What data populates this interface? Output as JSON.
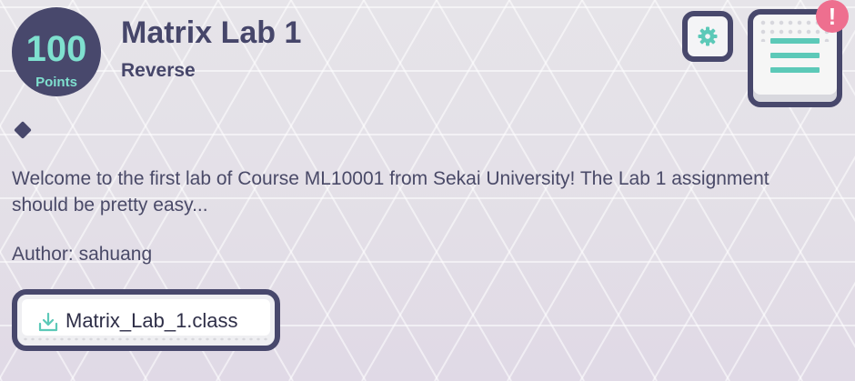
{
  "challenge": {
    "points_value": "100",
    "points_label": "Points",
    "title": "Matrix Lab 1",
    "category": "Reverse",
    "description": "Welcome to the first lab of Course ML10001 from Sekai University! The Lab 1 assignment should be pretty easy...",
    "author_label": "Author:",
    "author_name": "sahuang",
    "attachment_name": "Matrix_Lab_1.class"
  },
  "controls": {
    "settings_icon": "gear-icon",
    "menu_icon": "menu-lines-icon",
    "alert_text": "!",
    "download_icon": "download-icon",
    "difficulty_icon": "diamond-icon"
  },
  "colors": {
    "dark": "#48486c",
    "accent": "#5cc9b8",
    "points_text": "#7fe0cf",
    "alert": "#ee6f8f"
  }
}
